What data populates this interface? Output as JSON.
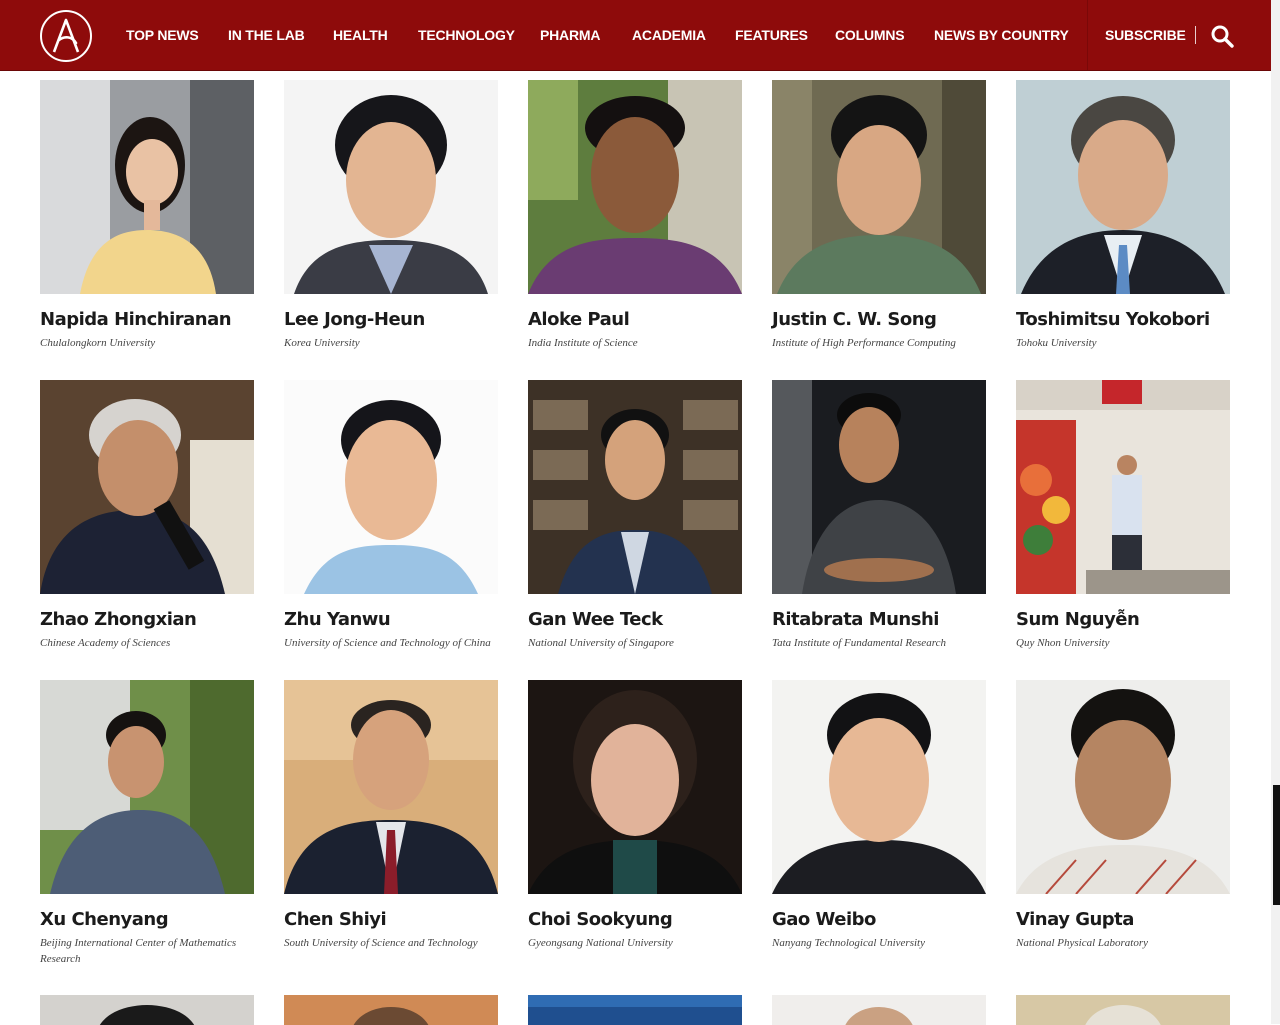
{
  "header": {
    "brand_color": "#8e0b0b",
    "logo_letter": "A",
    "nav": [
      "TOP NEWS",
      "IN THE LAB",
      "HEALTH",
      "TECHNOLOGY",
      "PHARMA",
      "ACADEMIA",
      "FEATURES",
      "COLUMNS",
      "NEWS BY COUNTRY"
    ],
    "subscribe": "SUBSCRIBE",
    "search_icon": "search-icon"
  },
  "people": [
    {
      "name": "Napida Hinchiranan",
      "affiliation": "Chulalongkorn University"
    },
    {
      "name": "Lee Jong-Heun",
      "affiliation": "Korea University"
    },
    {
      "name": "Aloke Paul",
      "affiliation": "India Institute of Science"
    },
    {
      "name": "Justin C. W. Song",
      "affiliation": "Institute of High Performance Computing"
    },
    {
      "name": "Toshimitsu Yokobori",
      "affiliation": "Tohoku University"
    },
    {
      "name": "Zhao Zhongxian",
      "affiliation": "Chinese Academy of Sciences"
    },
    {
      "name": "Zhu Yanwu",
      "affiliation": "University of Science and Technology of China"
    },
    {
      "name": "Gan Wee Teck",
      "affiliation": "National University of Singapore"
    },
    {
      "name": "Ritabrata Munshi",
      "affiliation": "Tata Institute of Fundamental Research"
    },
    {
      "name": "Sum Nguyễn",
      "affiliation": "Quy Nhon University"
    },
    {
      "name": "Xu Chenyang",
      "affiliation": "Beijing International Center of Mathematics Research"
    },
    {
      "name": "Chen Shiyi",
      "affiliation": "South University of Science and Technology"
    },
    {
      "name": "Choi Sookyung",
      "affiliation": "Gyeongsang National University"
    },
    {
      "name": "Gao Weibo",
      "affiliation": "Nanyang Technological University"
    },
    {
      "name": "Vinay Gupta",
      "affiliation": "National Physical Laboratory"
    }
  ]
}
